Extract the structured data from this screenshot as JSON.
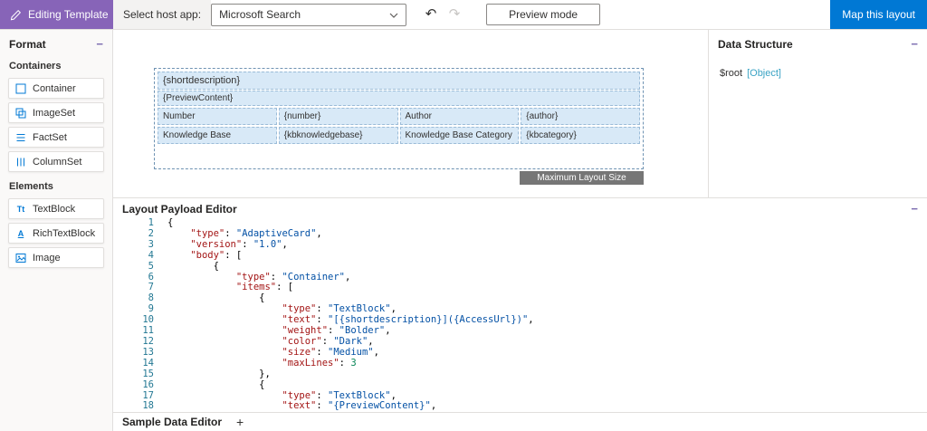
{
  "colors": {
    "brand_purple": "#8764b8",
    "accent_blue": "#0078d4",
    "highlight_blue": "#d8e9f7",
    "badge_gray": "#767676"
  },
  "icons": {
    "undo_icon": "↶",
    "redo_icon": "↷",
    "collapse_icon": "−",
    "add_icon": "+"
  },
  "topbar": {
    "title": "Editing Template",
    "host_app_label": "Select host app:",
    "host_app_value": "Microsoft Search",
    "preview_button": "Preview mode",
    "map_button": "Map this layout"
  },
  "sidebar": {
    "title": "Format",
    "sections": [
      {
        "label": "Containers",
        "items": [
          {
            "id": "container",
            "label": "Container"
          },
          {
            "id": "imageset",
            "label": "ImageSet"
          },
          {
            "id": "factset",
            "label": "FactSet"
          },
          {
            "id": "columnset",
            "label": "ColumnSet"
          }
        ]
      },
      {
        "label": "Elements",
        "items": [
          {
            "id": "textblock",
            "label": "TextBlock"
          },
          {
            "id": "richtextblock",
            "label": "RichTextBlock"
          },
          {
            "id": "image",
            "label": "Image"
          }
        ]
      }
    ]
  },
  "canvas": {
    "card": {
      "title": "{shortdescription}",
      "preview_content": "{PreviewContent}",
      "facts": [
        {
          "label": "Number",
          "value": "{number}"
        },
        {
          "label": "Author",
          "value": "{author}"
        },
        {
          "label": "Knowledge Base",
          "value": "{kbknowledgebase}"
        },
        {
          "label": "Knowledge Base Category",
          "value": "{kbcategory}"
        }
      ]
    },
    "max_layout_label": "Maximum Layout Size"
  },
  "data_structure": {
    "title": "Data Structure",
    "root_label": "$root",
    "root_type": "[Object]"
  },
  "payload_editor": {
    "title": "Layout Payload Editor",
    "lines": [
      "{",
      "    \"type\": \"AdaptiveCard\",",
      "    \"version\": \"1.0\",",
      "    \"body\": [",
      "        {",
      "            \"type\": \"Container\",",
      "            \"items\": [",
      "                {",
      "                    \"type\": \"TextBlock\",",
      "                    \"text\": \"[{shortdescription}]({AccessUrl})\",",
      "                    \"weight\": \"Bolder\",",
      "                    \"color\": \"Dark\",",
      "                    \"size\": \"Medium\",",
      "                    \"maxLines\": 3",
      "                },",
      "                {",
      "                    \"type\": \"TextBlock\",",
      "                    \"text\": \"{PreviewContent}\","
    ]
  },
  "sample_data_editor": {
    "title": "Sample Data Editor"
  }
}
